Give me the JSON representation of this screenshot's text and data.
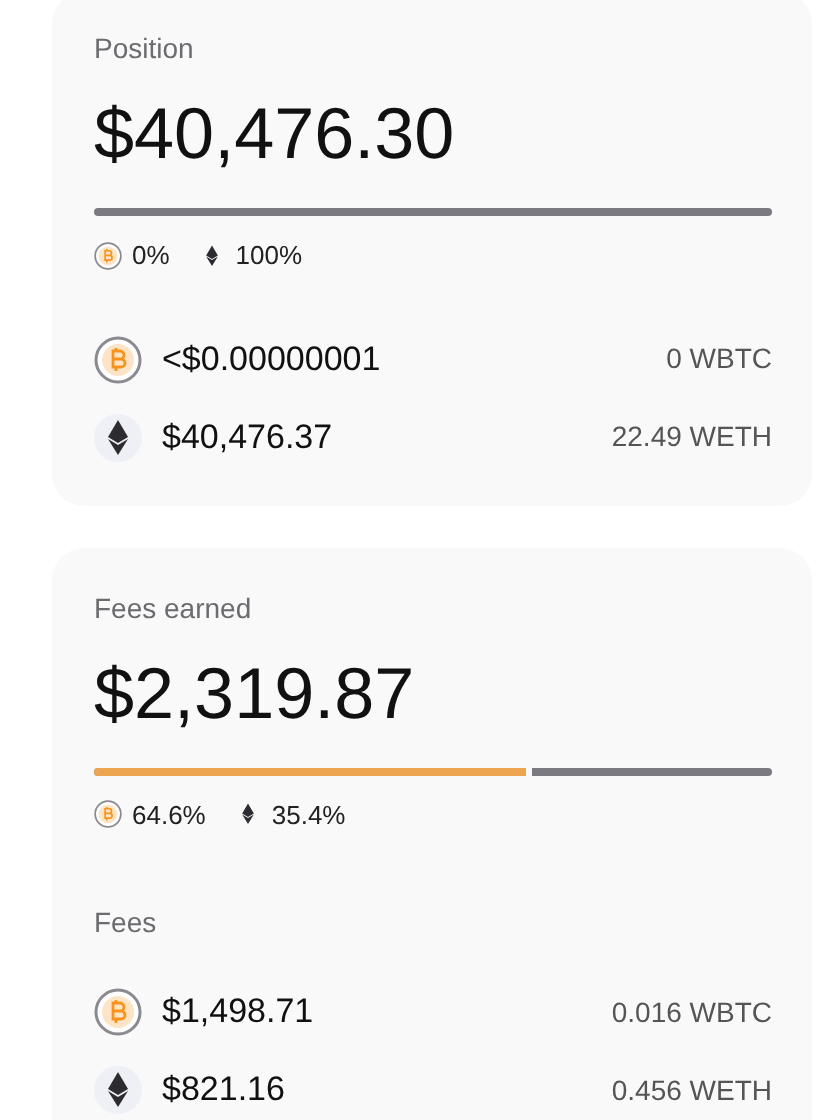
{
  "cards": [
    {
      "title": "Position",
      "total": "$40,476.30",
      "split": {
        "level": 0
      },
      "legend": [
        {
          "kind": "btc",
          "percent": "0%"
        },
        {
          "kind": "eth",
          "percent": "100%"
        }
      ],
      "rows": [
        {
          "kind": "btc",
          "value": "<$0.00000001",
          "amount": "0 WBTC"
        },
        {
          "kind": "eth",
          "value": "$40,476.37",
          "amount": "22.49 WETH"
        }
      ]
    },
    {
      "title": "Fees earned",
      "total": "$2,319.87",
      "split": {
        "level": 0.646
      },
      "legend": [
        {
          "kind": "btc",
          "percent": "64.6%"
        },
        {
          "kind": "eth",
          "percent": "35.4%"
        }
      ],
      "section": "Fees",
      "rows": [
        {
          "kind": "btc",
          "value": "$1,498.71",
          "amount": "0.016 WBTC"
        },
        {
          "kind": "eth",
          "value": "$821.16",
          "amount": "0.456 WETH"
        }
      ]
    }
  ]
}
